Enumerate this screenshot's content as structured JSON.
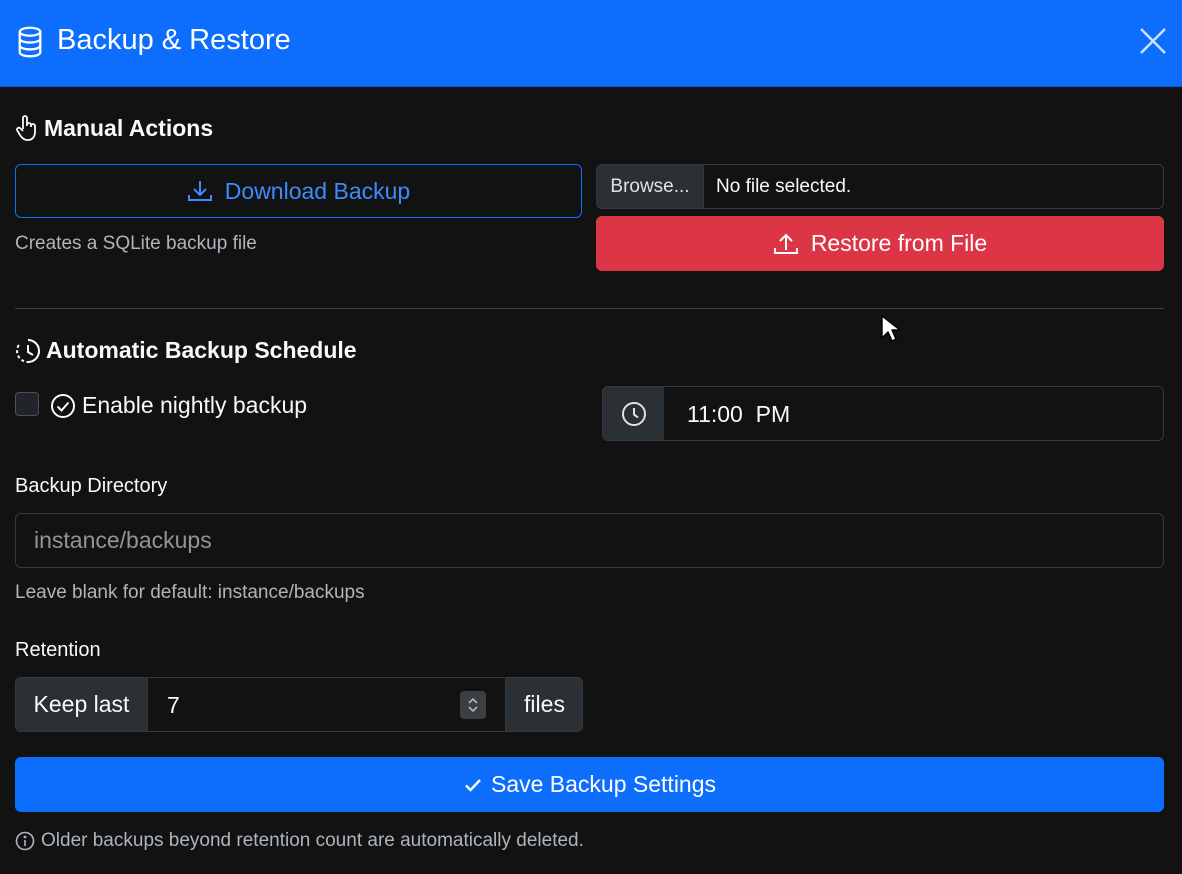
{
  "header": {
    "title": "Backup & Restore",
    "icon": "database-icon",
    "close_icon": "close-icon",
    "color": "#0d6efd"
  },
  "manual": {
    "title": "Manual Actions",
    "icon": "hand-pointer-icon",
    "download_label": "Download Backup",
    "download_help": "Creates a SQLite backup file",
    "browse_label": "Browse...",
    "file_status": "No file selected.",
    "restore_label": "Restore from File",
    "restore_color": "#dc3545"
  },
  "schedule": {
    "title": "Automatic Backup Schedule",
    "icon": "clock-history-icon",
    "enable_label": "Enable nightly backup",
    "enabled": false,
    "time_value": "11:00  PM"
  },
  "directory": {
    "label": "Backup Directory",
    "placeholder": "instance/backups",
    "value": "",
    "help": "Leave blank for default: instance/backups"
  },
  "retention": {
    "label": "Retention",
    "prefix": "Keep last",
    "value": "7",
    "suffix": "files"
  },
  "save_label": "Save Backup Settings",
  "footnote": "Older backups beyond retention count are automatically deleted."
}
